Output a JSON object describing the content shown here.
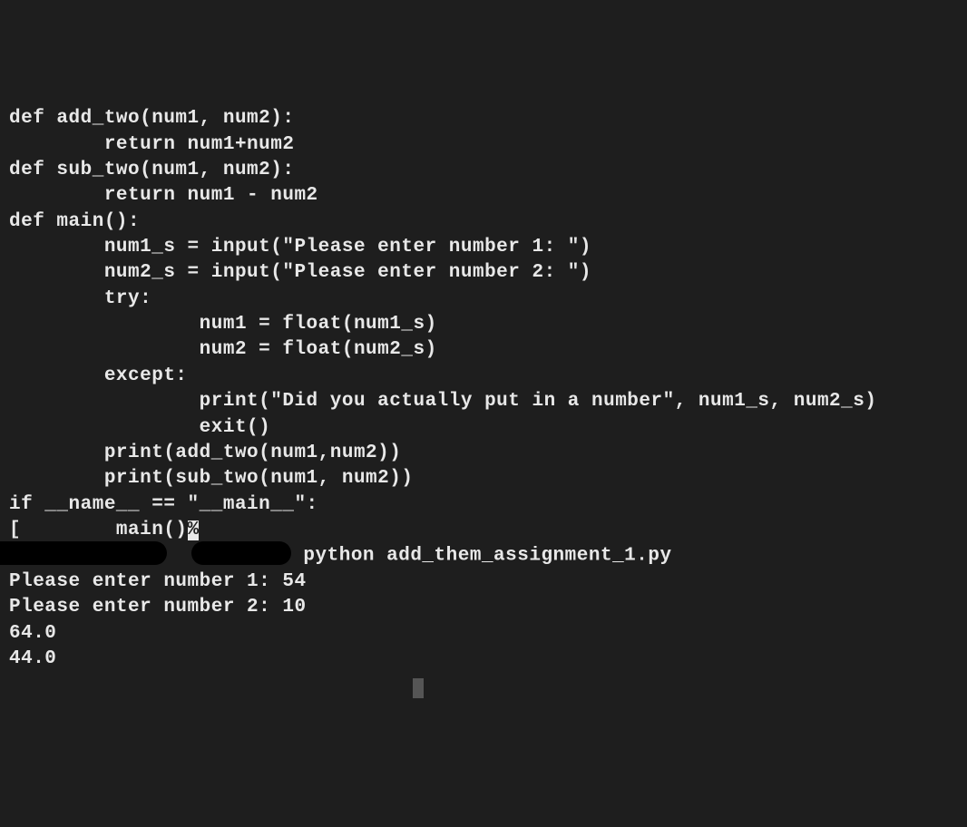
{
  "code": {
    "l1": "def add_two(num1, num2):",
    "l2": "        return num1+num2",
    "l3": "",
    "l4": "def sub_two(num1, num2):",
    "l5": "        return num1 - num2",
    "l6": "",
    "l7": "def main():",
    "l8": "        num1_s = input(\"Please enter number 1: \")",
    "l9": "        num2_s = input(\"Please enter number 2: \")",
    "l10": "",
    "l11": "        try:",
    "l12": "                num1 = float(num1_s)",
    "l13": "                num2 = float(num2_s)",
    "l14": "        except:",
    "l15": "                print(\"Did you actually put in a number\", num1_s, num2_s)",
    "l16": "                exit()",
    "l17": "",
    "l18": "        print(add_two(num1,num2))",
    "l19": "        print(sub_two(num1, num2))",
    "l20": "",
    "l21": "if __name__ == \"__main__\":",
    "l22_prefix": "        main()",
    "l22_cursor": "%"
  },
  "shell": {
    "bracket": "[",
    "command": " python add_them_assignment_1.py"
  },
  "output": {
    "o1": "Please enter number 1: 54",
    "o2": "Please enter number 2: 10",
    "o3": "64.0",
    "o4": "44.0"
  }
}
